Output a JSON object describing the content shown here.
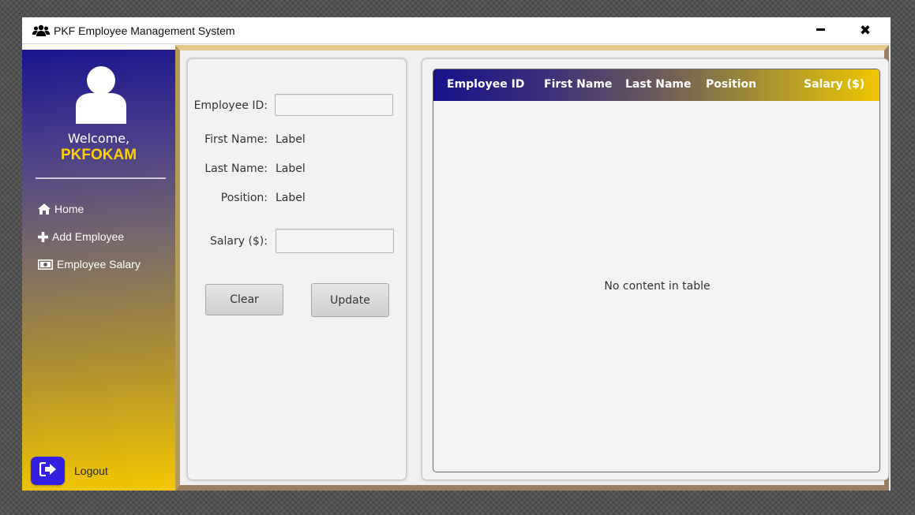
{
  "window": {
    "title": "PKF Employee Management System",
    "title_icon": "users-icon",
    "minimize_icon": "minimize-icon",
    "close_symbol": "✖"
  },
  "sidebar": {
    "welcome": "Welcome,",
    "username": "PKFOKAM",
    "items": [
      {
        "label": "Home",
        "icon": "home-icon"
      },
      {
        "label": "Add Employee",
        "icon": "plus-icon"
      },
      {
        "label": "Employee Salary",
        "icon": "money-icon"
      }
    ],
    "logout_label": "Logout",
    "colors": {
      "top": "#1a1590",
      "bottom": "#f4c800",
      "username": "#ffd000",
      "logout_button": "#3320e0"
    }
  },
  "form": {
    "employee_id_label": "Employee ID:",
    "employee_id_value": "",
    "first_name_label": "First Name:",
    "first_name_value": "Label",
    "last_name_label": "Last Name:",
    "last_name_value": "Label",
    "position_label": "Position:",
    "position_value": "Label",
    "salary_label": "Salary ($):",
    "salary_value": "",
    "clear_button": "Clear",
    "update_button": "Update"
  },
  "table": {
    "columns": [
      "Employee ID",
      "First Name",
      "Last Name",
      "Position",
      "Salary ($)"
    ],
    "rows": [],
    "empty_message": "No content in table"
  }
}
